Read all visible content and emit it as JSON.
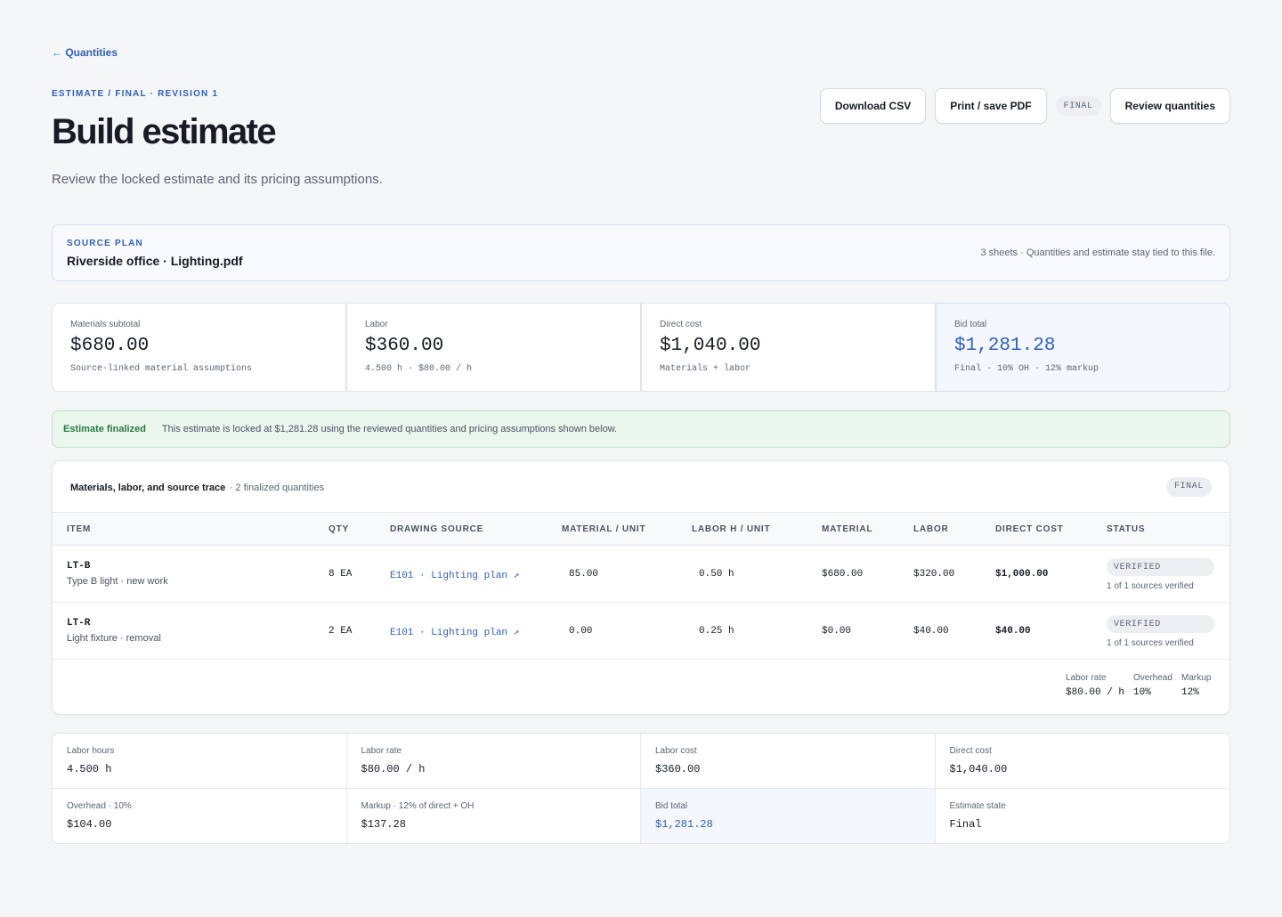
{
  "nav": {
    "back_label": "← Quantities"
  },
  "header": {
    "crumb": "ESTIMATE / FINAL · REVISION 1",
    "title": "Build estimate",
    "subtitle": "Review the locked estimate and its pricing assumptions."
  },
  "actions": {
    "download_csv": "Download CSV",
    "print_pdf": "Print / save PDF",
    "state_pill": "FINAL",
    "review": "Review quantities"
  },
  "source": {
    "label": "SOURCE PLAN",
    "file": "Riverside office · Lighting.pdf",
    "note": "3 sheets · Quantities and estimate stay tied to this file."
  },
  "metrics": [
    {
      "label": "Materials subtotal",
      "value": "$680.00",
      "sub": "Source-linked material assumptions"
    },
    {
      "label": "Labor",
      "value": "$360.00",
      "sub": "4.500 h · $80.00 / h"
    },
    {
      "label": "Direct cost",
      "value": "$1,040.00",
      "sub": "Materials + labor"
    },
    {
      "label": "Bid total",
      "value": "$1,281.28",
      "sub": "Final · 10% OH · 12% markup"
    }
  ],
  "banner": {
    "title": "Estimate finalized",
    "text": "This estimate is locked at $1,281.28 using the reviewed quantities and pricing assumptions shown below."
  },
  "table": {
    "title": "Materials, labor, and source trace",
    "count": "· 2 finalized quantities",
    "state_pill": "FINAL",
    "columns": [
      "ITEM",
      "QTY",
      "DRAWING SOURCE",
      "MATERIAL / UNIT",
      "LABOR H / UNIT",
      "MATERIAL",
      "LABOR",
      "DIRECT COST",
      "STATUS"
    ],
    "rows": [
      {
        "code": "LT-B",
        "desc": "Type B light · new work",
        "qty": "8 EA",
        "source": "E101 · Lighting plan ↗",
        "material_unit": "85.00",
        "labor_unit": "0.50 h",
        "material": "$680.00",
        "labor": "$320.00",
        "direct": "$1,000.00",
        "status": "VERIFIED",
        "status_note": "1 of 1 sources verified"
      },
      {
        "code": "LT-R",
        "desc": "Light fixture · removal",
        "qty": "2 EA",
        "source": "E101 · Lighting plan ↗",
        "material_unit": "0.00",
        "labor_unit": "0.25 h",
        "material": "$0.00",
        "labor": "$40.00",
        "direct": "$40.00",
        "status": "VERIFIED",
        "status_note": "1 of 1 sources verified"
      }
    ],
    "rates": [
      {
        "label": "Labor rate",
        "value": "$80.00 / h"
      },
      {
        "label": "Overhead",
        "value": "10%"
      },
      {
        "label": "Markup",
        "value": "12%"
      }
    ]
  },
  "breakdown": [
    {
      "label": "Labor hours",
      "value": "4.500 h"
    },
    {
      "label": "Labor rate",
      "value": "$80.00 / h"
    },
    {
      "label": "Labor cost",
      "value": "$360.00"
    },
    {
      "label": "Direct cost",
      "value": "$1,040.00"
    },
    {
      "label": "Overhead · 10%",
      "value": "$104.00"
    },
    {
      "label": "Markup · 12% of direct + OH",
      "value": "$137.28"
    },
    {
      "label": "Bid total",
      "value": "$1,281.28"
    },
    {
      "label": "Estimate state",
      "value": "Final"
    }
  ],
  "colors": {
    "accent": "#2f5fb8",
    "success": "#2a7a3f",
    "background": "#f5f6f8"
  }
}
